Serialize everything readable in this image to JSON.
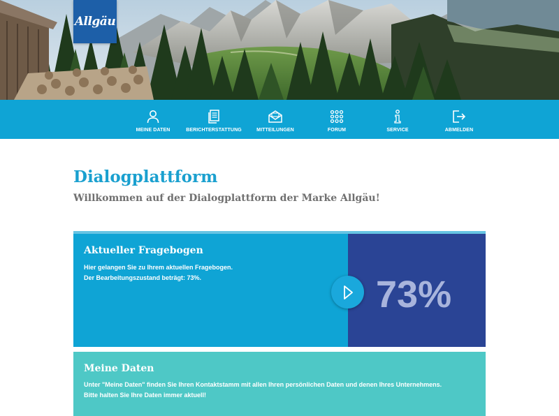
{
  "brand": {
    "logo_text": "Allgäu"
  },
  "nav": {
    "items": [
      {
        "label": "MEINE DATEN",
        "icon": "user-icon"
      },
      {
        "label": "BERICHTERSTATTUNG",
        "icon": "documents-icon"
      },
      {
        "label": "MITTEILUNGEN",
        "icon": "envelope-icon"
      },
      {
        "label": "FORUM",
        "icon": "grid-dots-icon"
      },
      {
        "label": "SERVICE",
        "icon": "info-icon"
      },
      {
        "label": "ABMELDEN",
        "icon": "logout-icon"
      }
    ]
  },
  "main": {
    "title": "Dialogplattform",
    "subtitle": "Willkommen auf der Dialogplattform der Marke Allgäu!"
  },
  "questionnaire": {
    "title": "Aktueller Fragebogen",
    "line1": "Hier gelangen Sie zu Ihrem aktuellen Fragebogen.",
    "line2": "Der Bearbeitungszustand beträgt: 73%.",
    "progress_label": "73%",
    "progress": 0.73
  },
  "my_data": {
    "title": "Meine Daten",
    "line1": "Unter \"Meine Daten\" finden Sie Ihren Kontaktstamm mit allen Ihren persönlichen Daten und denen Ihres Unternehmens.",
    "line2": "Bitte halten Sie Ihre Daten immer aktuell!"
  },
  "colors": {
    "nav_bg": "#0fa4d5",
    "title_blue": "#1aa0cf",
    "card_blue": "#0fa4d5",
    "card_navy": "#2a4495",
    "card_teal": "#4ec8c6",
    "logo_blue": "#1d5fa8"
  }
}
